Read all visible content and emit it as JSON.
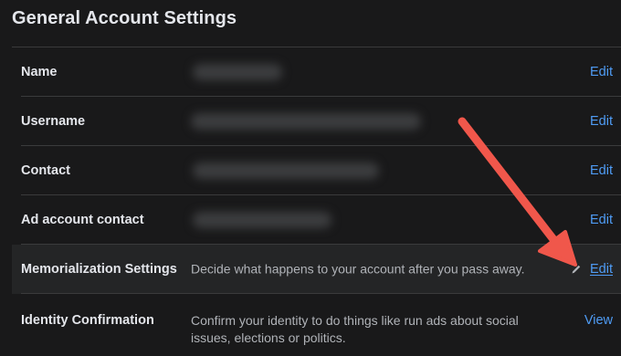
{
  "page": {
    "title": "General Account Settings"
  },
  "rows": [
    {
      "label": "Name",
      "action": "Edit"
    },
    {
      "label": "Username",
      "action": "Edit"
    },
    {
      "label": "Contact",
      "action": "Edit"
    },
    {
      "label": "Ad account contact",
      "action": "Edit"
    },
    {
      "label": "Memorialization Settings",
      "description": "Decide what happens to your account after you pass away.",
      "action": "Edit"
    },
    {
      "label": "Identity Confirmation",
      "description_line1": "Confirm your identity to do things like run ads about social",
      "description_line2": "issues, elections or politics.",
      "action": "View"
    }
  ],
  "colors": {
    "background": "#19191a",
    "highlight_row": "#242526",
    "link": "#4f9cf5",
    "annotation_arrow": "#f0574b"
  },
  "icons": {
    "edit_pencil": "pencil-icon"
  }
}
